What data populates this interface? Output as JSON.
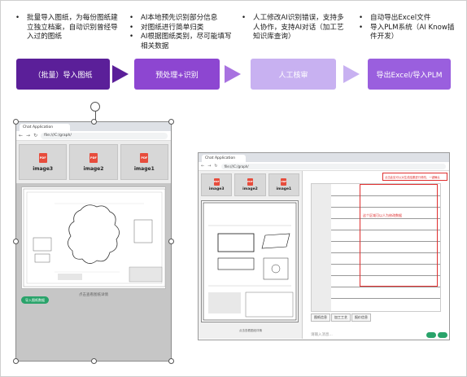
{
  "columns": [
    {
      "bullets": [
        "批量导入图纸，为每份图纸建立独立档案，自动识别曾经导入过的图纸"
      ]
    },
    {
      "bullets": [
        "AI本地预先识别部分信息",
        "对图纸进行简单归类",
        "AI根据图纸类别，尽可能填写相关数据"
      ]
    },
    {
      "bullets": [
        "人工修改AI识别错误，支持多人协作，支持AI对话（加工艺知识库查询）"
      ]
    },
    {
      "bullets": [
        "自动导出Excel文件",
        "导入PLM系统（AI Know插件开发）"
      ]
    }
  ],
  "steps": [
    {
      "label": "（批量）导入图纸"
    },
    {
      "label": "预处理+识别"
    },
    {
      "label": "人工核审"
    },
    {
      "label": "导出Excel/导入PLM"
    }
  ],
  "left_app": {
    "tab_title": "Chat Application",
    "url": "file:///C:/graph/",
    "thumbs": [
      "image3",
      "image2",
      "image1"
    ],
    "caption": "点击查看图纸详情",
    "button": "导入图纸数据"
  },
  "right_app": {
    "tab_title": "Chat Application",
    "url": "file:///C:/graph/",
    "thumbs": [
      "image3",
      "image2",
      "image1"
    ],
    "caption": "点击查看图纸详情",
    "annotation_top": "点击此处可以对生成结果进行修改、一键确认",
    "annotation_mid": "这个区域可以人为修改数据",
    "tabs": [
      "图纸信息",
      "加工工艺",
      "报价信息"
    ],
    "input_placeholder": "请输入消息..."
  }
}
